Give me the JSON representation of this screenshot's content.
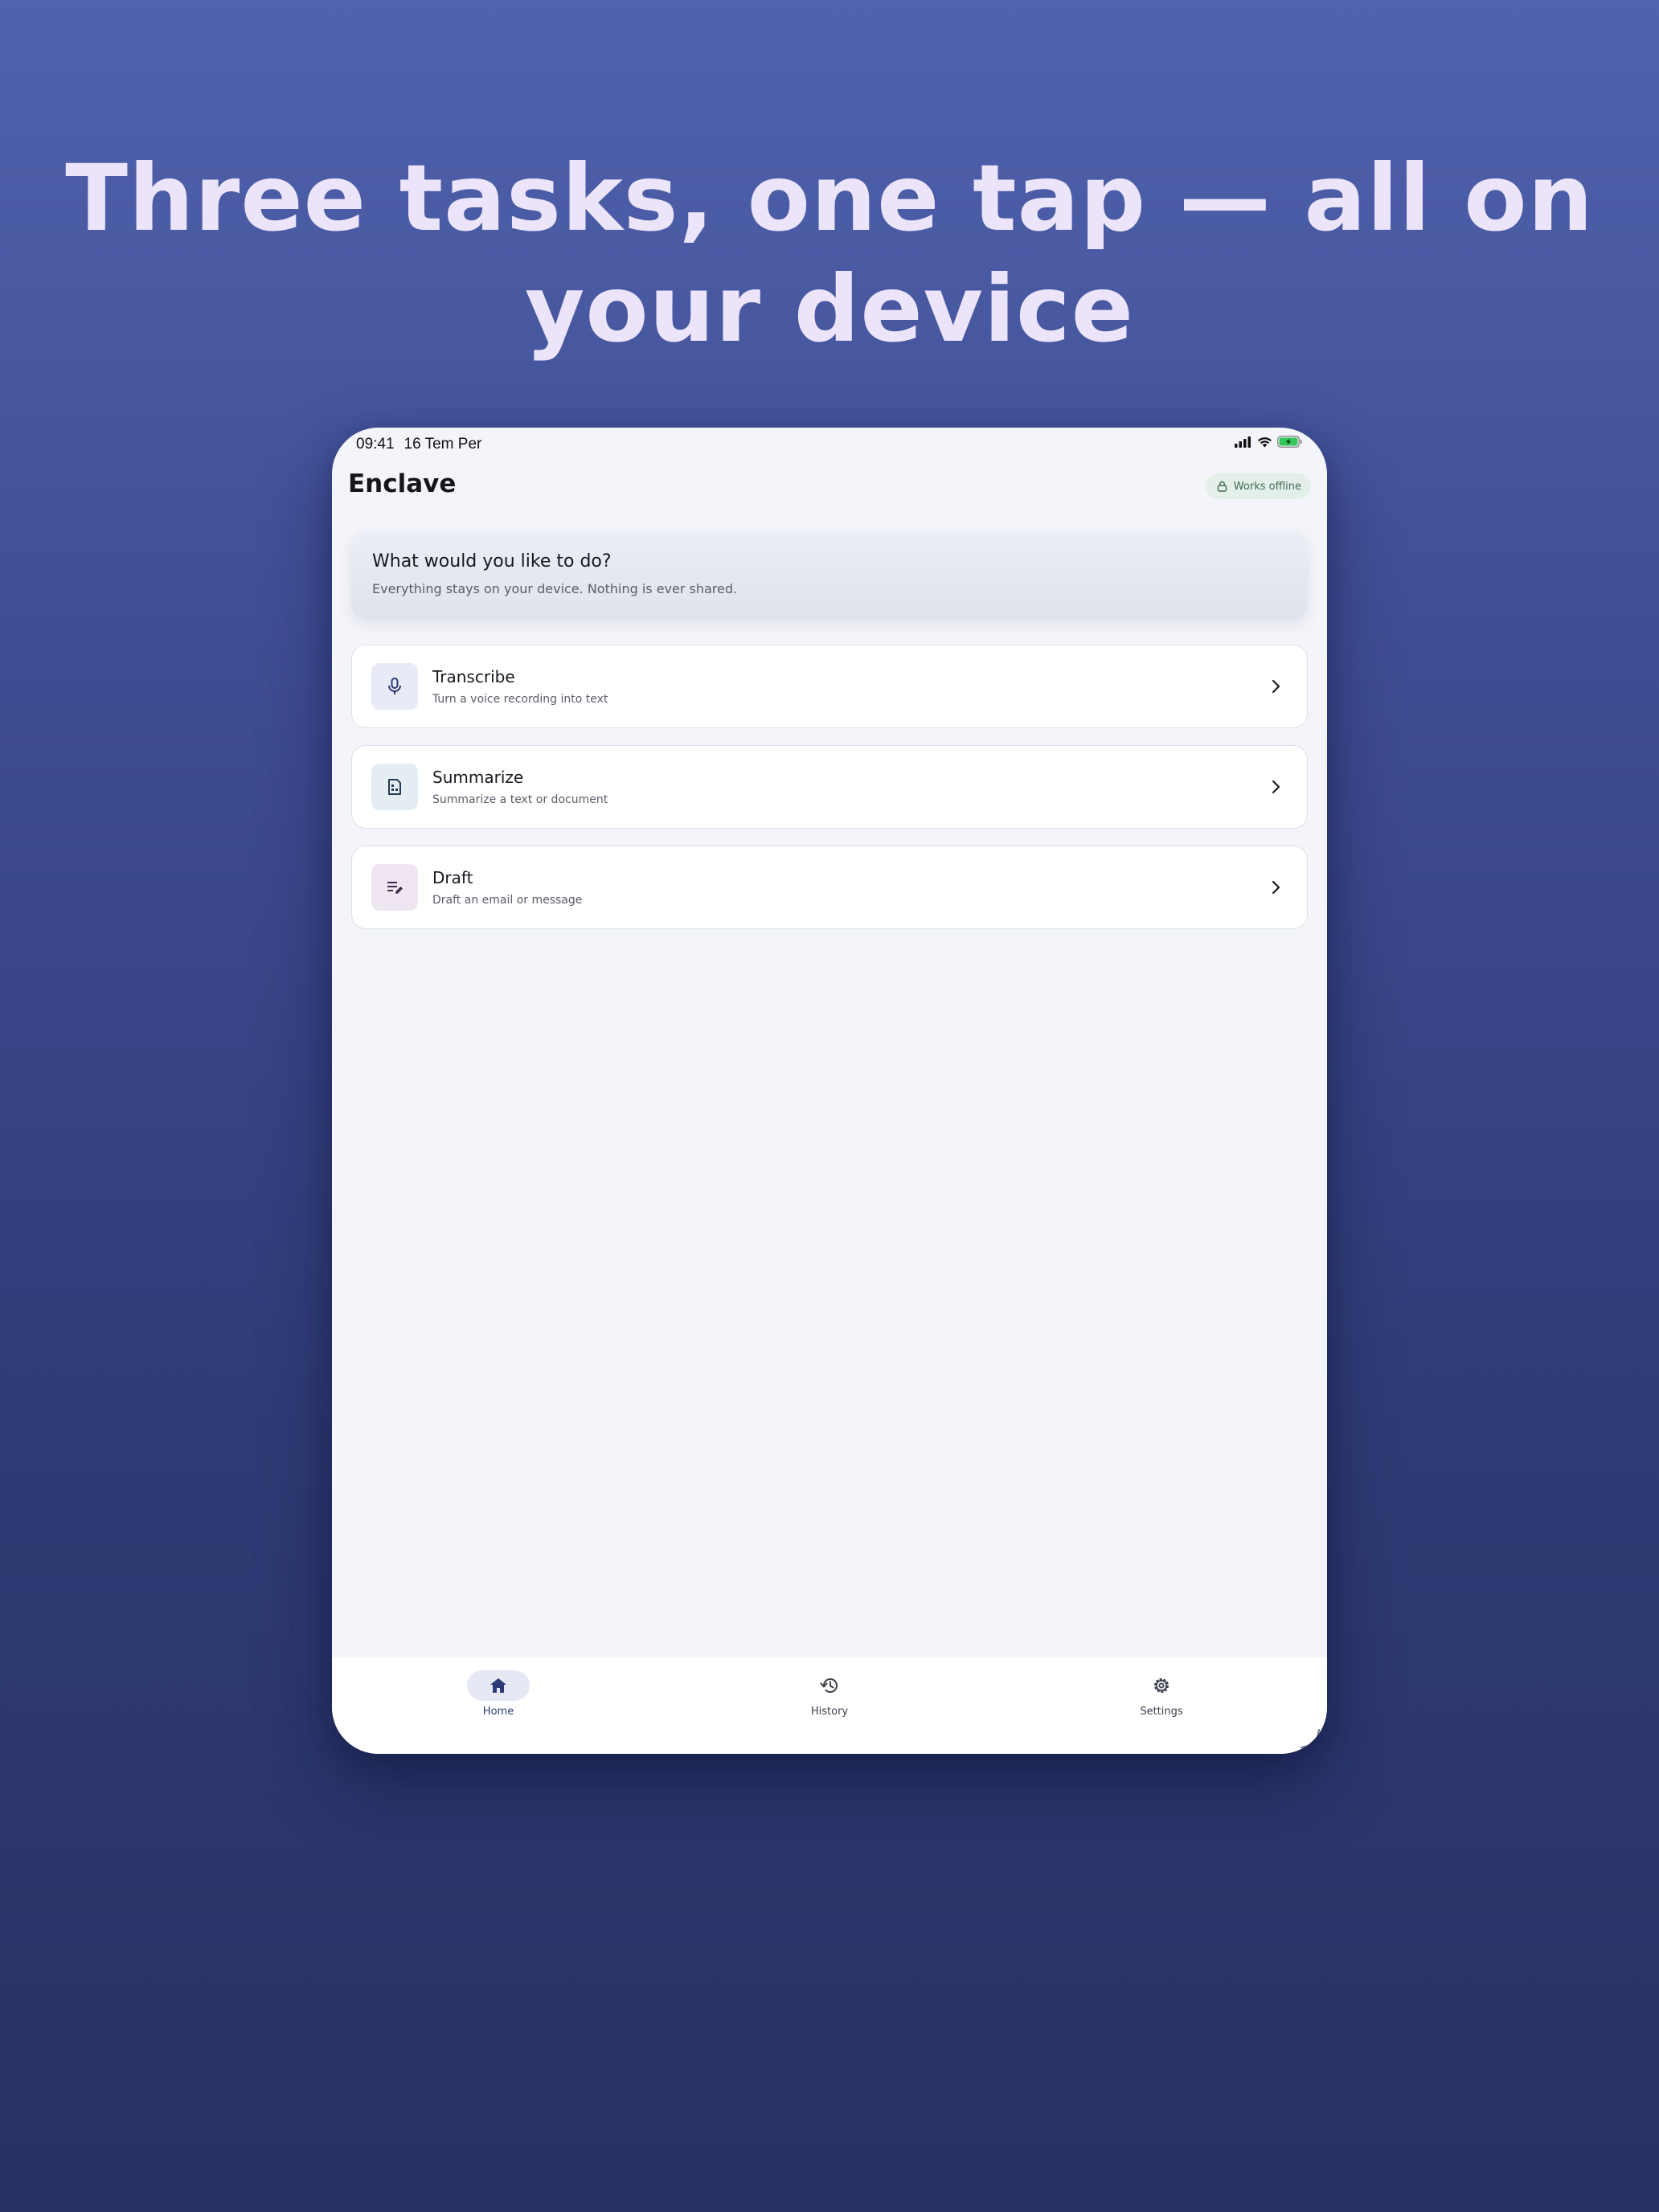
{
  "headline": {
    "line1": "Three tasks, one tap — all on",
    "line2": "your device"
  },
  "status_bar": {
    "time": "09:41",
    "date": "16 Tem Per"
  },
  "app": {
    "title": "Enclave",
    "offline_badge": "Works offline"
  },
  "hero": {
    "title": "What would you like to do?",
    "subtitle": "Everything stays on your device. Nothing is ever shared."
  },
  "tasks": [
    {
      "title": "Transcribe",
      "subtitle": "Turn a voice recording into text",
      "icon": "microphone-icon",
      "icon_bg": "#e8eaf5"
    },
    {
      "title": "Summarize",
      "subtitle": "Summarize a text or document",
      "icon": "document-icon",
      "icon_bg": "#e4edf3"
    },
    {
      "title": "Draft",
      "subtitle": "Draft an email or message",
      "icon": "edit-note-icon",
      "icon_bg": "#efe6f2"
    }
  ],
  "nav": [
    {
      "label": "Home",
      "icon": "home-icon",
      "active": true
    },
    {
      "label": "History",
      "icon": "history-icon",
      "active": false
    },
    {
      "label": "Settings",
      "icon": "gear-icon",
      "active": false
    }
  ],
  "colors": {
    "accent": "#2c3a76",
    "badge_bg": "#e4efea",
    "badge_text": "#3f6a56",
    "battery": "#34c759"
  }
}
